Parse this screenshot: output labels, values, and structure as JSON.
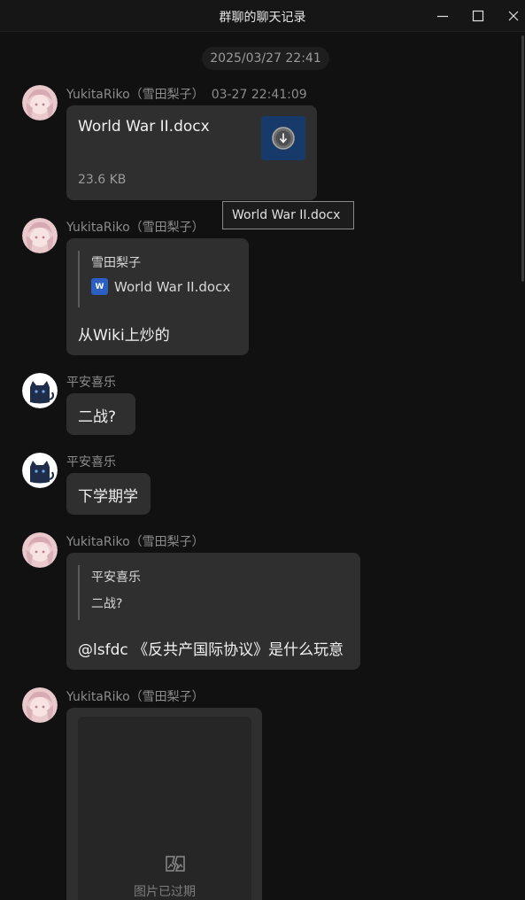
{
  "window": {
    "title": "群聊的聊天记录",
    "controls": {
      "minimize_icon": "minimize-icon",
      "maximize_icon": "maximize-icon",
      "close_icon": "close-icon"
    }
  },
  "date_divider": "2025/03/27 22:41",
  "tooltip": "World War II.docx",
  "messages": [
    {
      "type": "file",
      "sender": "YukitaRiko（雪田梨子）",
      "time": "03-27 22:41:09",
      "avatar": "anime-avatar",
      "file_name": "World War II.docx",
      "file_size": "23.6 KB",
      "file_icon": "download-file-icon"
    },
    {
      "type": "reply",
      "sender": "YukitaRiko（雪田梨子）",
      "avatar": "anime-avatar",
      "quote_author": "雪田梨子",
      "quote_file": "World War II.docx",
      "quote_file_icon": "word-doc-icon",
      "text": "从Wiki上炒的"
    },
    {
      "type": "text",
      "sender": "平安喜乐",
      "avatar": "cat-avatar",
      "text": "二战?"
    },
    {
      "type": "text",
      "sender": "平安喜乐",
      "avatar": "cat-avatar",
      "text": "下学期学"
    },
    {
      "type": "reply",
      "sender": "YukitaRiko（雪田梨子）",
      "avatar": "anime-avatar",
      "quote_author": "平安喜乐",
      "quote_text": "二战?",
      "text": "@lsfdc 《反共产国际协议》是什么玩意"
    },
    {
      "type": "image",
      "sender": "YukitaRiko（雪田梨子）",
      "avatar": "anime-avatar",
      "expired_icon": "broken-image-icon",
      "expired_text": "图片已过期"
    }
  ]
}
